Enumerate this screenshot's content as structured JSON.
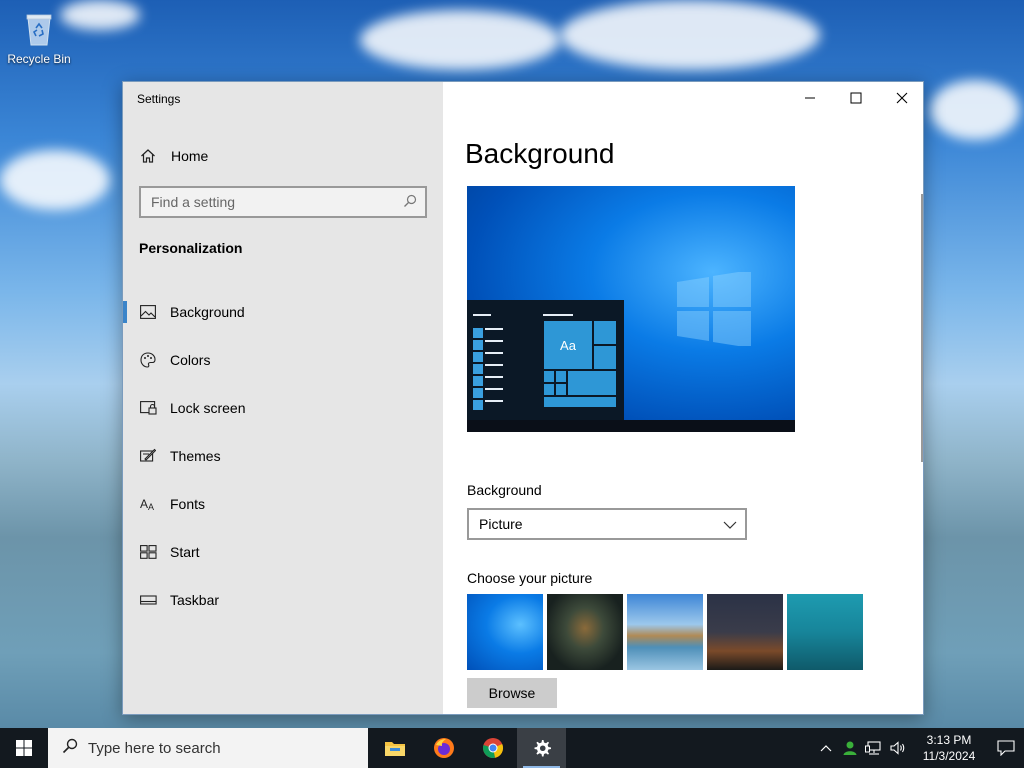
{
  "desktop": {
    "icons": [
      {
        "label": "Recycle Bin",
        "icon": "recycle-bin-icon"
      }
    ]
  },
  "window": {
    "title": "Settings",
    "sidebar": {
      "home_label": "Home",
      "search_placeholder": "Find a setting",
      "section_title": "Personalization",
      "items": [
        {
          "label": "Background",
          "icon": "picture-icon",
          "active": true
        },
        {
          "label": "Colors",
          "icon": "palette-icon",
          "active": false
        },
        {
          "label": "Lock screen",
          "icon": "lock-screen-icon",
          "active": false
        },
        {
          "label": "Themes",
          "icon": "themes-icon",
          "active": false
        },
        {
          "label": "Fonts",
          "icon": "fonts-icon",
          "active": false
        },
        {
          "label": "Start",
          "icon": "start-icon",
          "active": false
        },
        {
          "label": "Taskbar",
          "icon": "taskbar-icon",
          "active": false
        }
      ]
    },
    "main": {
      "page_title": "Background",
      "preview_tile_text": "Aa",
      "background_label": "Background",
      "background_value": "Picture",
      "choose_picture_label": "Choose your picture",
      "browse_label": "Browse"
    }
  },
  "taskbar": {
    "search_placeholder": "Type here to search",
    "apps": [
      "file-explorer-icon",
      "firefox-icon",
      "chrome-icon",
      "settings-icon"
    ],
    "time": "3:13 PM",
    "date": "11/3/2024"
  },
  "colors": {
    "accent": "#3a84c9",
    "sidebar_bg": "#e6e6e6",
    "taskbar_bg": "#13191f"
  }
}
